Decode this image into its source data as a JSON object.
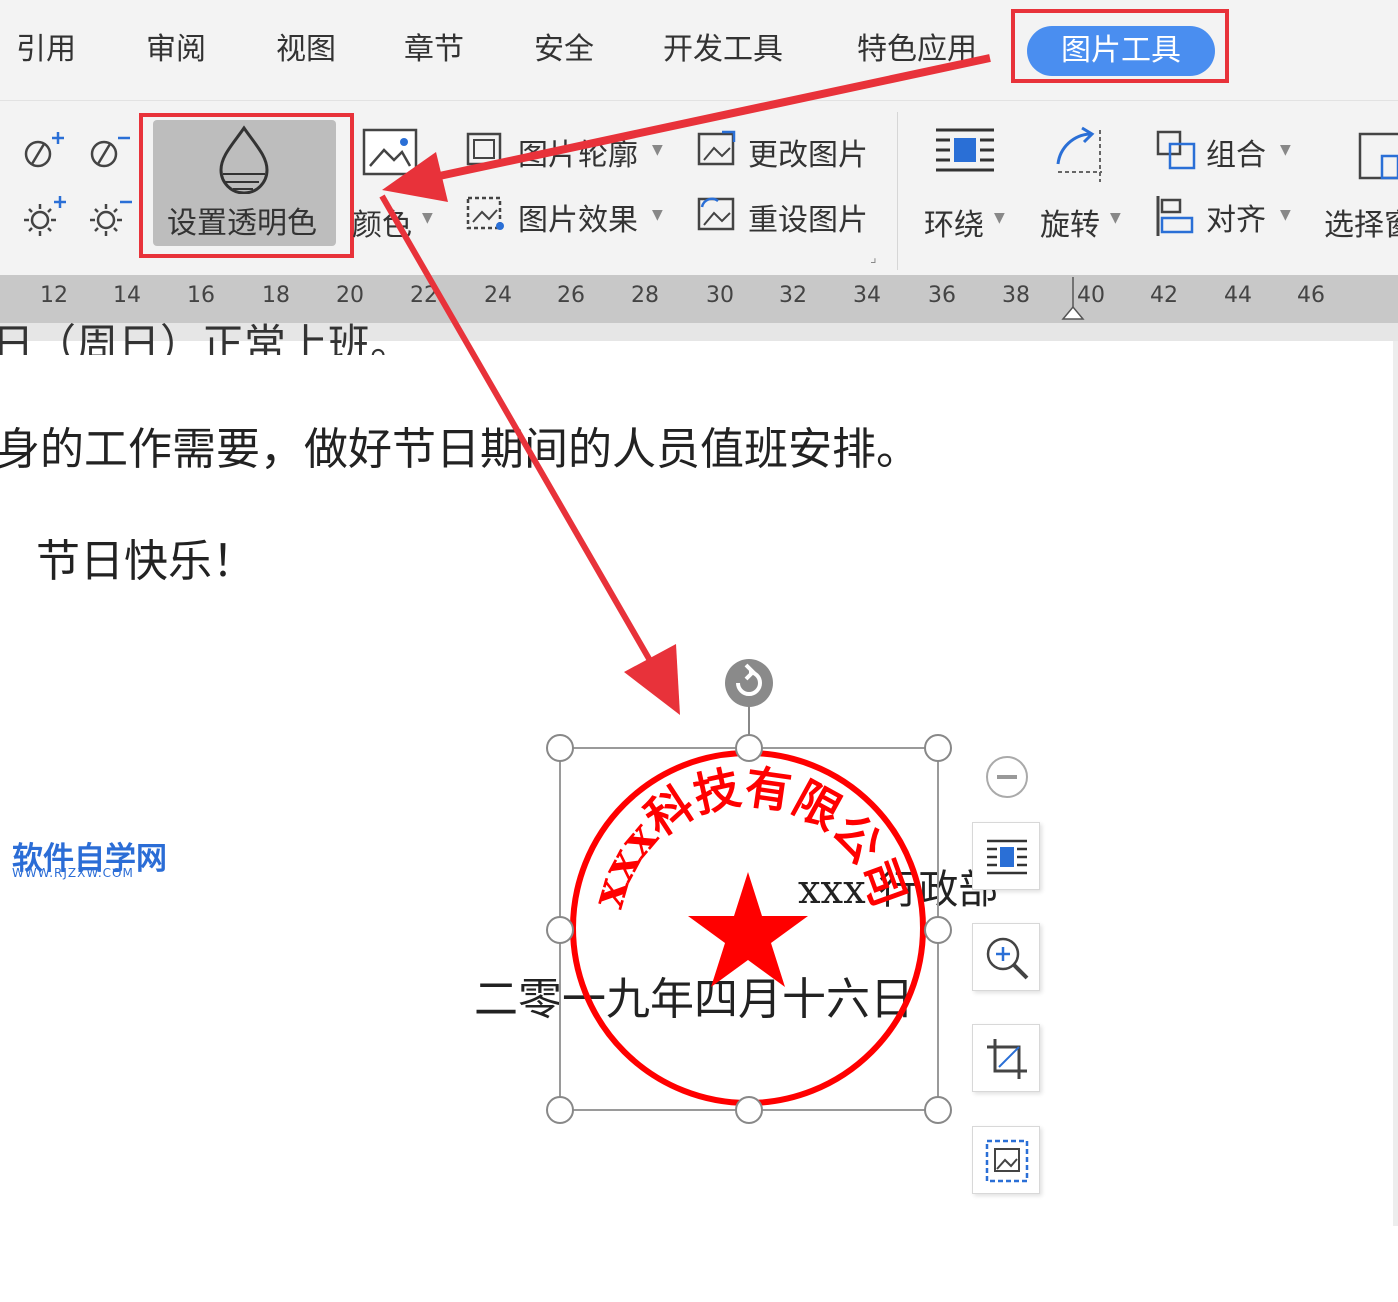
{
  "tabs": [
    "引用",
    "审阅",
    "视图",
    "章节",
    "安全",
    "开发工具",
    "特色应用"
  ],
  "active_tab": "图片工具",
  "ribbon": {
    "set_transparent_color": "设置透明色",
    "color": "颜色",
    "picture_border": "图片轮廓",
    "picture_effects": "图片效果",
    "change_picture": "更改图片",
    "reset_picture": "重设图片",
    "wrap": "环绕",
    "rotate": "旋转",
    "group": "组合",
    "align": "对齐",
    "select": "选择窗"
  },
  "ruler_ticks": [
    "12",
    "14",
    "16",
    "18",
    "20",
    "22",
    "24",
    "26",
    "28",
    "30",
    "32",
    "34",
    "36",
    "38",
    "40",
    "42",
    "44",
    "46"
  ],
  "document": {
    "line_partial": "日（周日）正常上班。",
    "line1": "身的工作需要，做好节日期间的人员值班安排。",
    "greeting": "节日快乐！",
    "department": "xxx 行政部",
    "date": "二零一九年四月十六日"
  },
  "stamp": {
    "company_text": "xxx科技有限公司",
    "color": "#ff0000"
  },
  "watermark": {
    "title": "软件自学网",
    "url": "WWW.RJZXW.COM"
  },
  "colors": {
    "accent": "#4a8ef0",
    "highlight": "#e8323a",
    "ribbon_bg": "#f3f3f3"
  }
}
